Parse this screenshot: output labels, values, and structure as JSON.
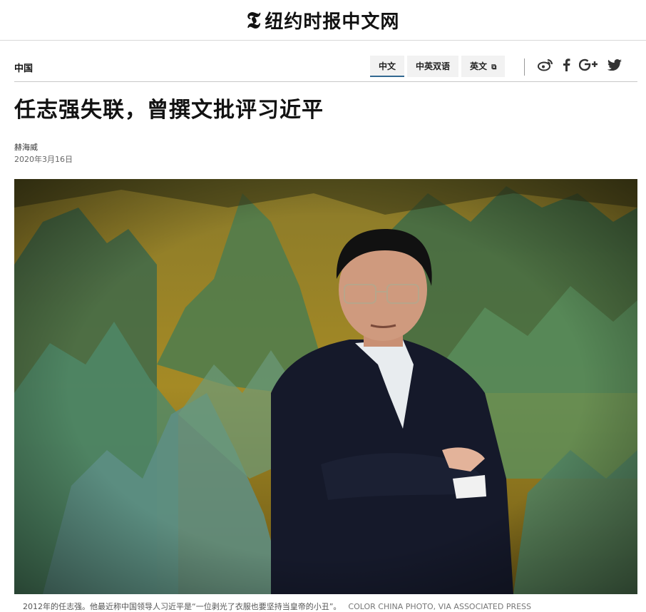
{
  "masthead": {
    "logo_glyph": "𝕿",
    "title": "纽约时报中文网"
  },
  "nav": {
    "section": "中国",
    "tabs": [
      {
        "label": "中文",
        "active": true
      },
      {
        "label": "中英双语",
        "active": false
      },
      {
        "label": "英文",
        "active": false,
        "external_icon": "⧉"
      }
    ],
    "social_icons": [
      "weibo-icon",
      "facebook-icon",
      "google-plus-icon",
      "twitter-icon"
    ]
  },
  "article": {
    "headline": "任志强失联，曾撰文批评习近平",
    "author": "赫海威",
    "date": "2020年3月16日"
  },
  "photo": {
    "caption": "2012年的任志强。他最近称中国领导人习近平是“一位剥光了衣服也要坚持当皇帝的小丑”。",
    "credit": "COLOR CHINA PHOTO, VIA ASSOCIATED PRESS"
  },
  "colors": {
    "accent": "#326891",
    "tab_bg": "#f2f2f2",
    "text": "#121212"
  }
}
